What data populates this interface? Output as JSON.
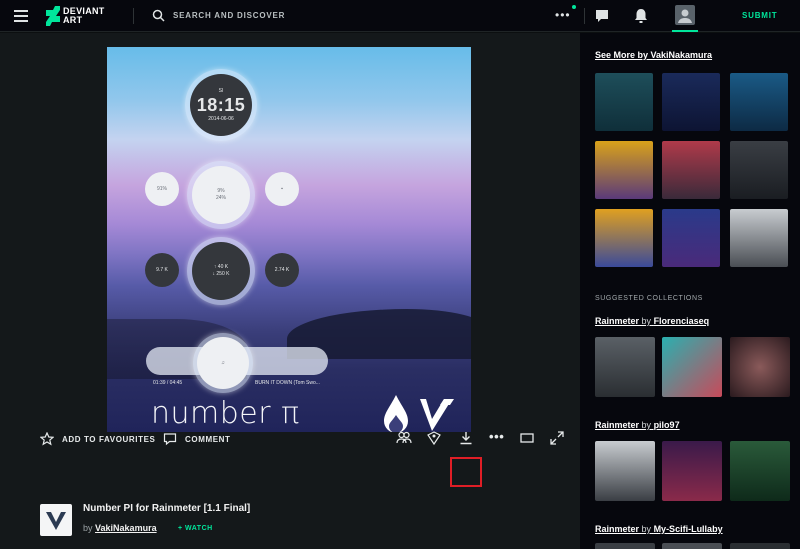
{
  "topbar": {
    "logo_line1": "DEVIANT",
    "logo_line2": "ART",
    "search_placeholder": "SEARCH AND DISCOVER",
    "more_label": "•••",
    "submit_label": "SUBMIT",
    "accent": "#00e59b",
    "icons": [
      "menu-icon",
      "search-icon",
      "chat-icon",
      "bell-icon",
      "user-avatar-icon"
    ]
  },
  "artwork": {
    "clock_small": "SI",
    "clock_time": "18:15",
    "clock_date": "2014-06-06",
    "cpu_label": "9%",
    "ram_label": "24%",
    "disk_left": "91%",
    "disk_right": "▪",
    "net_up": "↑ 40 K",
    "net_down": "↓ 250 K",
    "net_left": "9.7 K",
    "net_right": "2.74 K",
    "player_time": "01:39 / 04:45",
    "player_song": "BURN IT DOWN (Tom Swo...",
    "title": "number π"
  },
  "actions": {
    "favourite_label": "ADD TO FAVOURITES",
    "comment_label": "COMMENT",
    "more_label": "•••",
    "highlight_color": "#e01e26"
  },
  "deviation": {
    "title": "Number PI for Rainmeter [1.1 Final]",
    "by_prefix": "by",
    "author": "VakiNakamura",
    "watch_label": "+ WATCH"
  },
  "sidebar": {
    "more_by_label": "See More by VakiNakamura",
    "suggested_label": "SUGGESTED COLLECTIONS",
    "collections": [
      {
        "name": "Rainmeter",
        "by": "by",
        "author": "Florenciaseq"
      },
      {
        "name": "Rainmeter",
        "by": "by",
        "author": "pilo97"
      },
      {
        "name": "Rainmeter",
        "by": "by",
        "author": "My-Scifi-Lullaby"
      }
    ]
  }
}
